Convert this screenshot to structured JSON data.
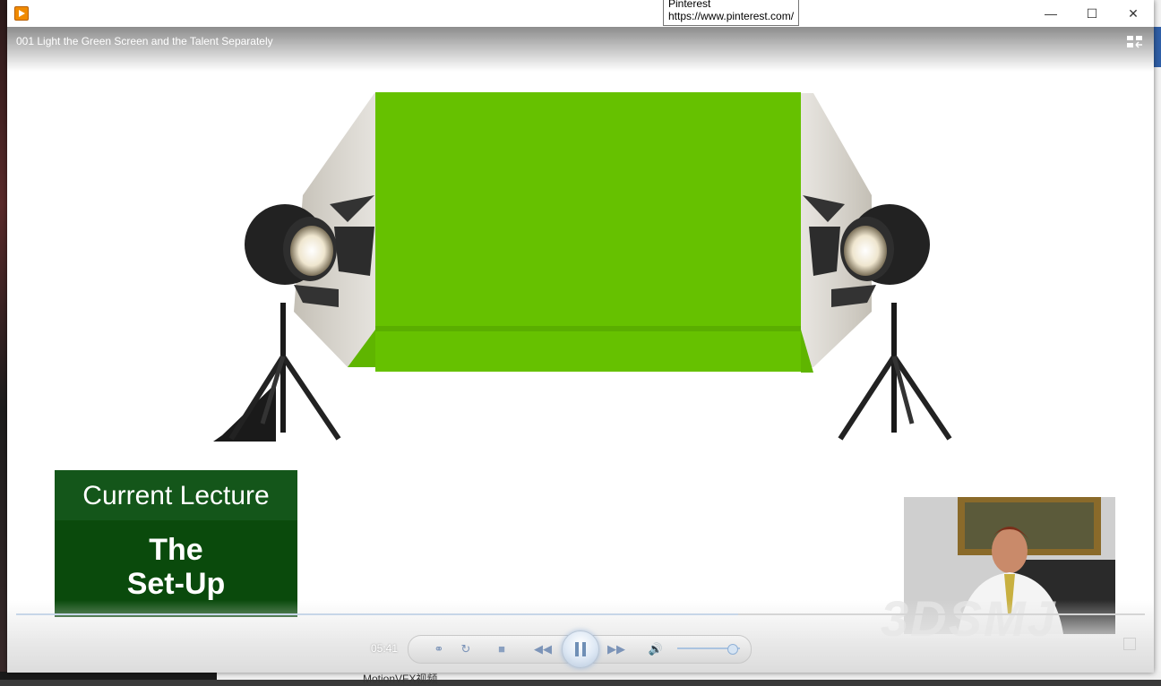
{
  "window": {
    "title_tooltip_top": "Pinterest",
    "title_tooltip_url": "https://www.pinterest.com/"
  },
  "video": {
    "title": "001 Light the Green Screen and the Talent Separately",
    "lecture_heading": "Current Lecture",
    "lecture_title_line1": "The",
    "lecture_title_line2": "Set-Up",
    "watermark": "3DSMJ"
  },
  "player": {
    "time": "05:41",
    "progress": 0.64,
    "volume": 0.85
  },
  "taskbar": {
    "partial_text": "MotionVFX视频"
  },
  "colors": {
    "green_screen": "#66c100",
    "lecture_bg": "#0a4a0c",
    "lecture_head": "#14561a",
    "accent": "#7c94b8"
  }
}
